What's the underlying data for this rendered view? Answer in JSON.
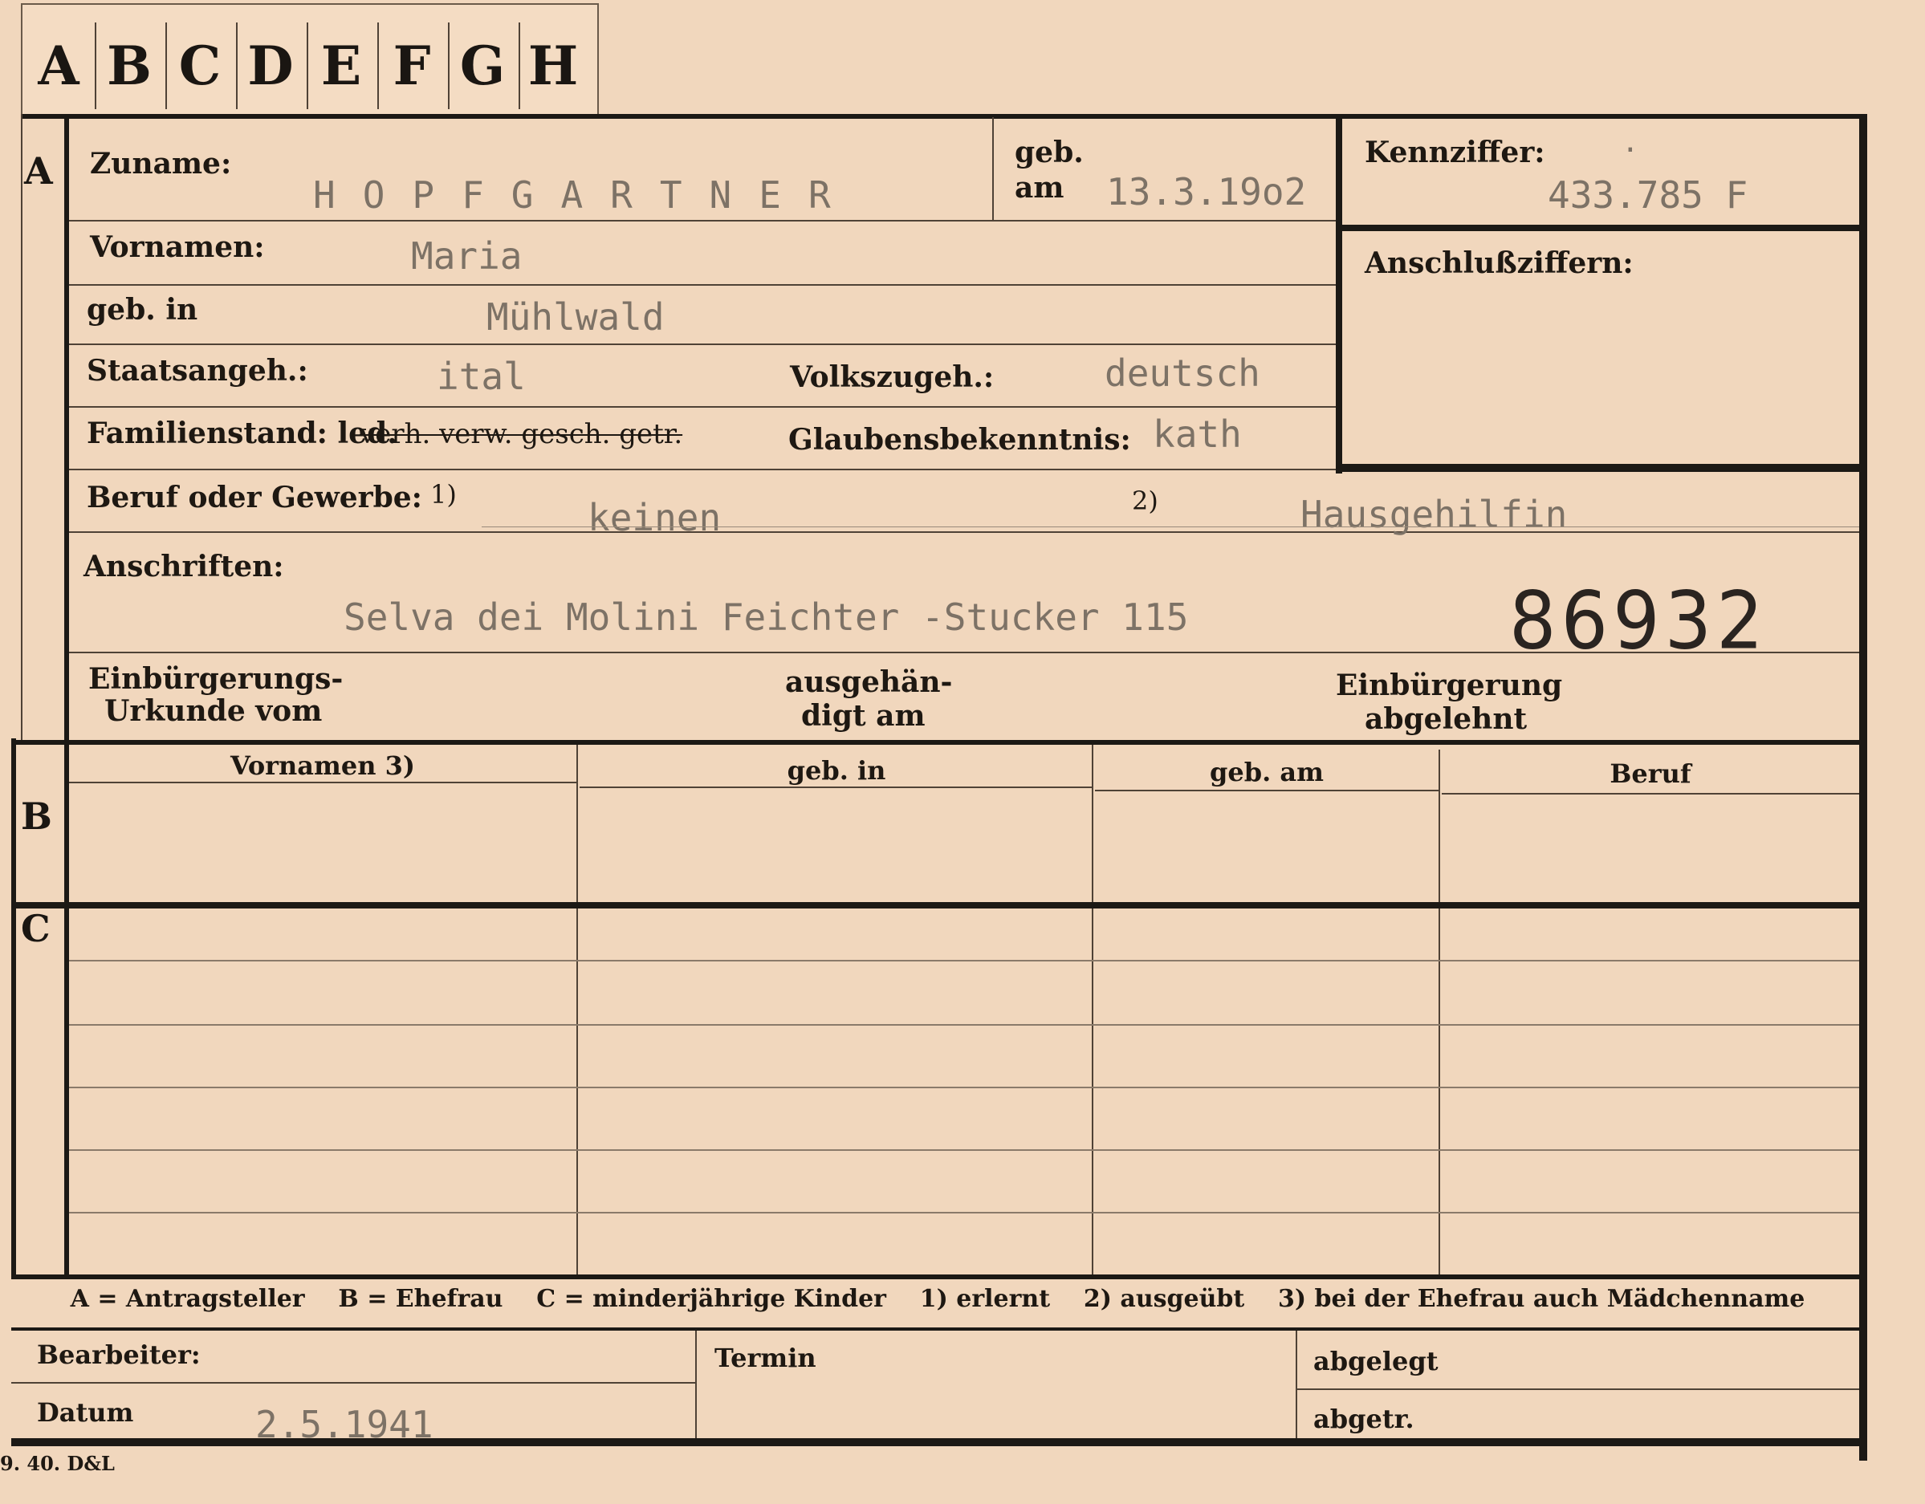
{
  "tabs": [
    "A",
    "B",
    "C",
    "D",
    "E",
    "F",
    "G",
    "H"
  ],
  "sections": {
    "a": "A",
    "b": "B",
    "c": "C"
  },
  "person": {
    "surname_label": "Zuname:",
    "surname": "HOPFGARTNER",
    "birth_label_1": "geb.",
    "birth_label_2": "am",
    "birth_date": "13.3.19o2",
    "id_label": "Kennziffer:",
    "id_dot": ".",
    "id_number": "433.785 F",
    "connection_label": "Anschlußziffern:",
    "firstname_label": "Vornamen:",
    "firstname": "Maria",
    "birthplace_label": "geb. in",
    "birthplace": "Mühlwald",
    "citizenship_label": "Staatsangeh.:",
    "citizenship": "ital",
    "ethnicity_label": "Volkszugeh.:",
    "ethnicity": "deutsch",
    "family_status_label": "Familienstand: led.",
    "family_status_struck": "verh. verw. gesch. getr.",
    "religion_label": "Glaubensbekenntnis:",
    "religion": "kath",
    "occupation_label": "Beruf oder Gewerbe:",
    "occupation_note_1": "1)",
    "occupation_1": "keinen",
    "occupation_note_2": "2)",
    "occupation_2": "Hausgehilfin",
    "address_label": "Anschriften:",
    "address": "Selva dei Molini  Feichter -Stucker 115",
    "stamp_number": "86932",
    "naturalization_label_1": "Einbürgerungs-",
    "naturalization_label_2": "Urkunde vom",
    "handed_label_1": "ausgehän-",
    "handed_label_2": "digt am",
    "rejected_label_1": "Einbürgerung",
    "rejected_label_2": "abgelehnt"
  },
  "table": {
    "headers": [
      "Vornamen 3)",
      "geb. in",
      "geb. am",
      "Beruf"
    ]
  },
  "legend": "A = Antragsteller    B = Ehefrau    C = minderjährige Kinder    1) erlernt    2) ausgeübt    3) bei der Ehefrau auch Mädchenname",
  "footer": {
    "processor_label": "Bearbeiter:",
    "date_label": "Datum",
    "date_value": "2.5.1941",
    "deadline_label": "Termin",
    "filed_label": "abgelegt",
    "sent_label": "abgetr.",
    "print_mark": "9. 40. D&L"
  }
}
